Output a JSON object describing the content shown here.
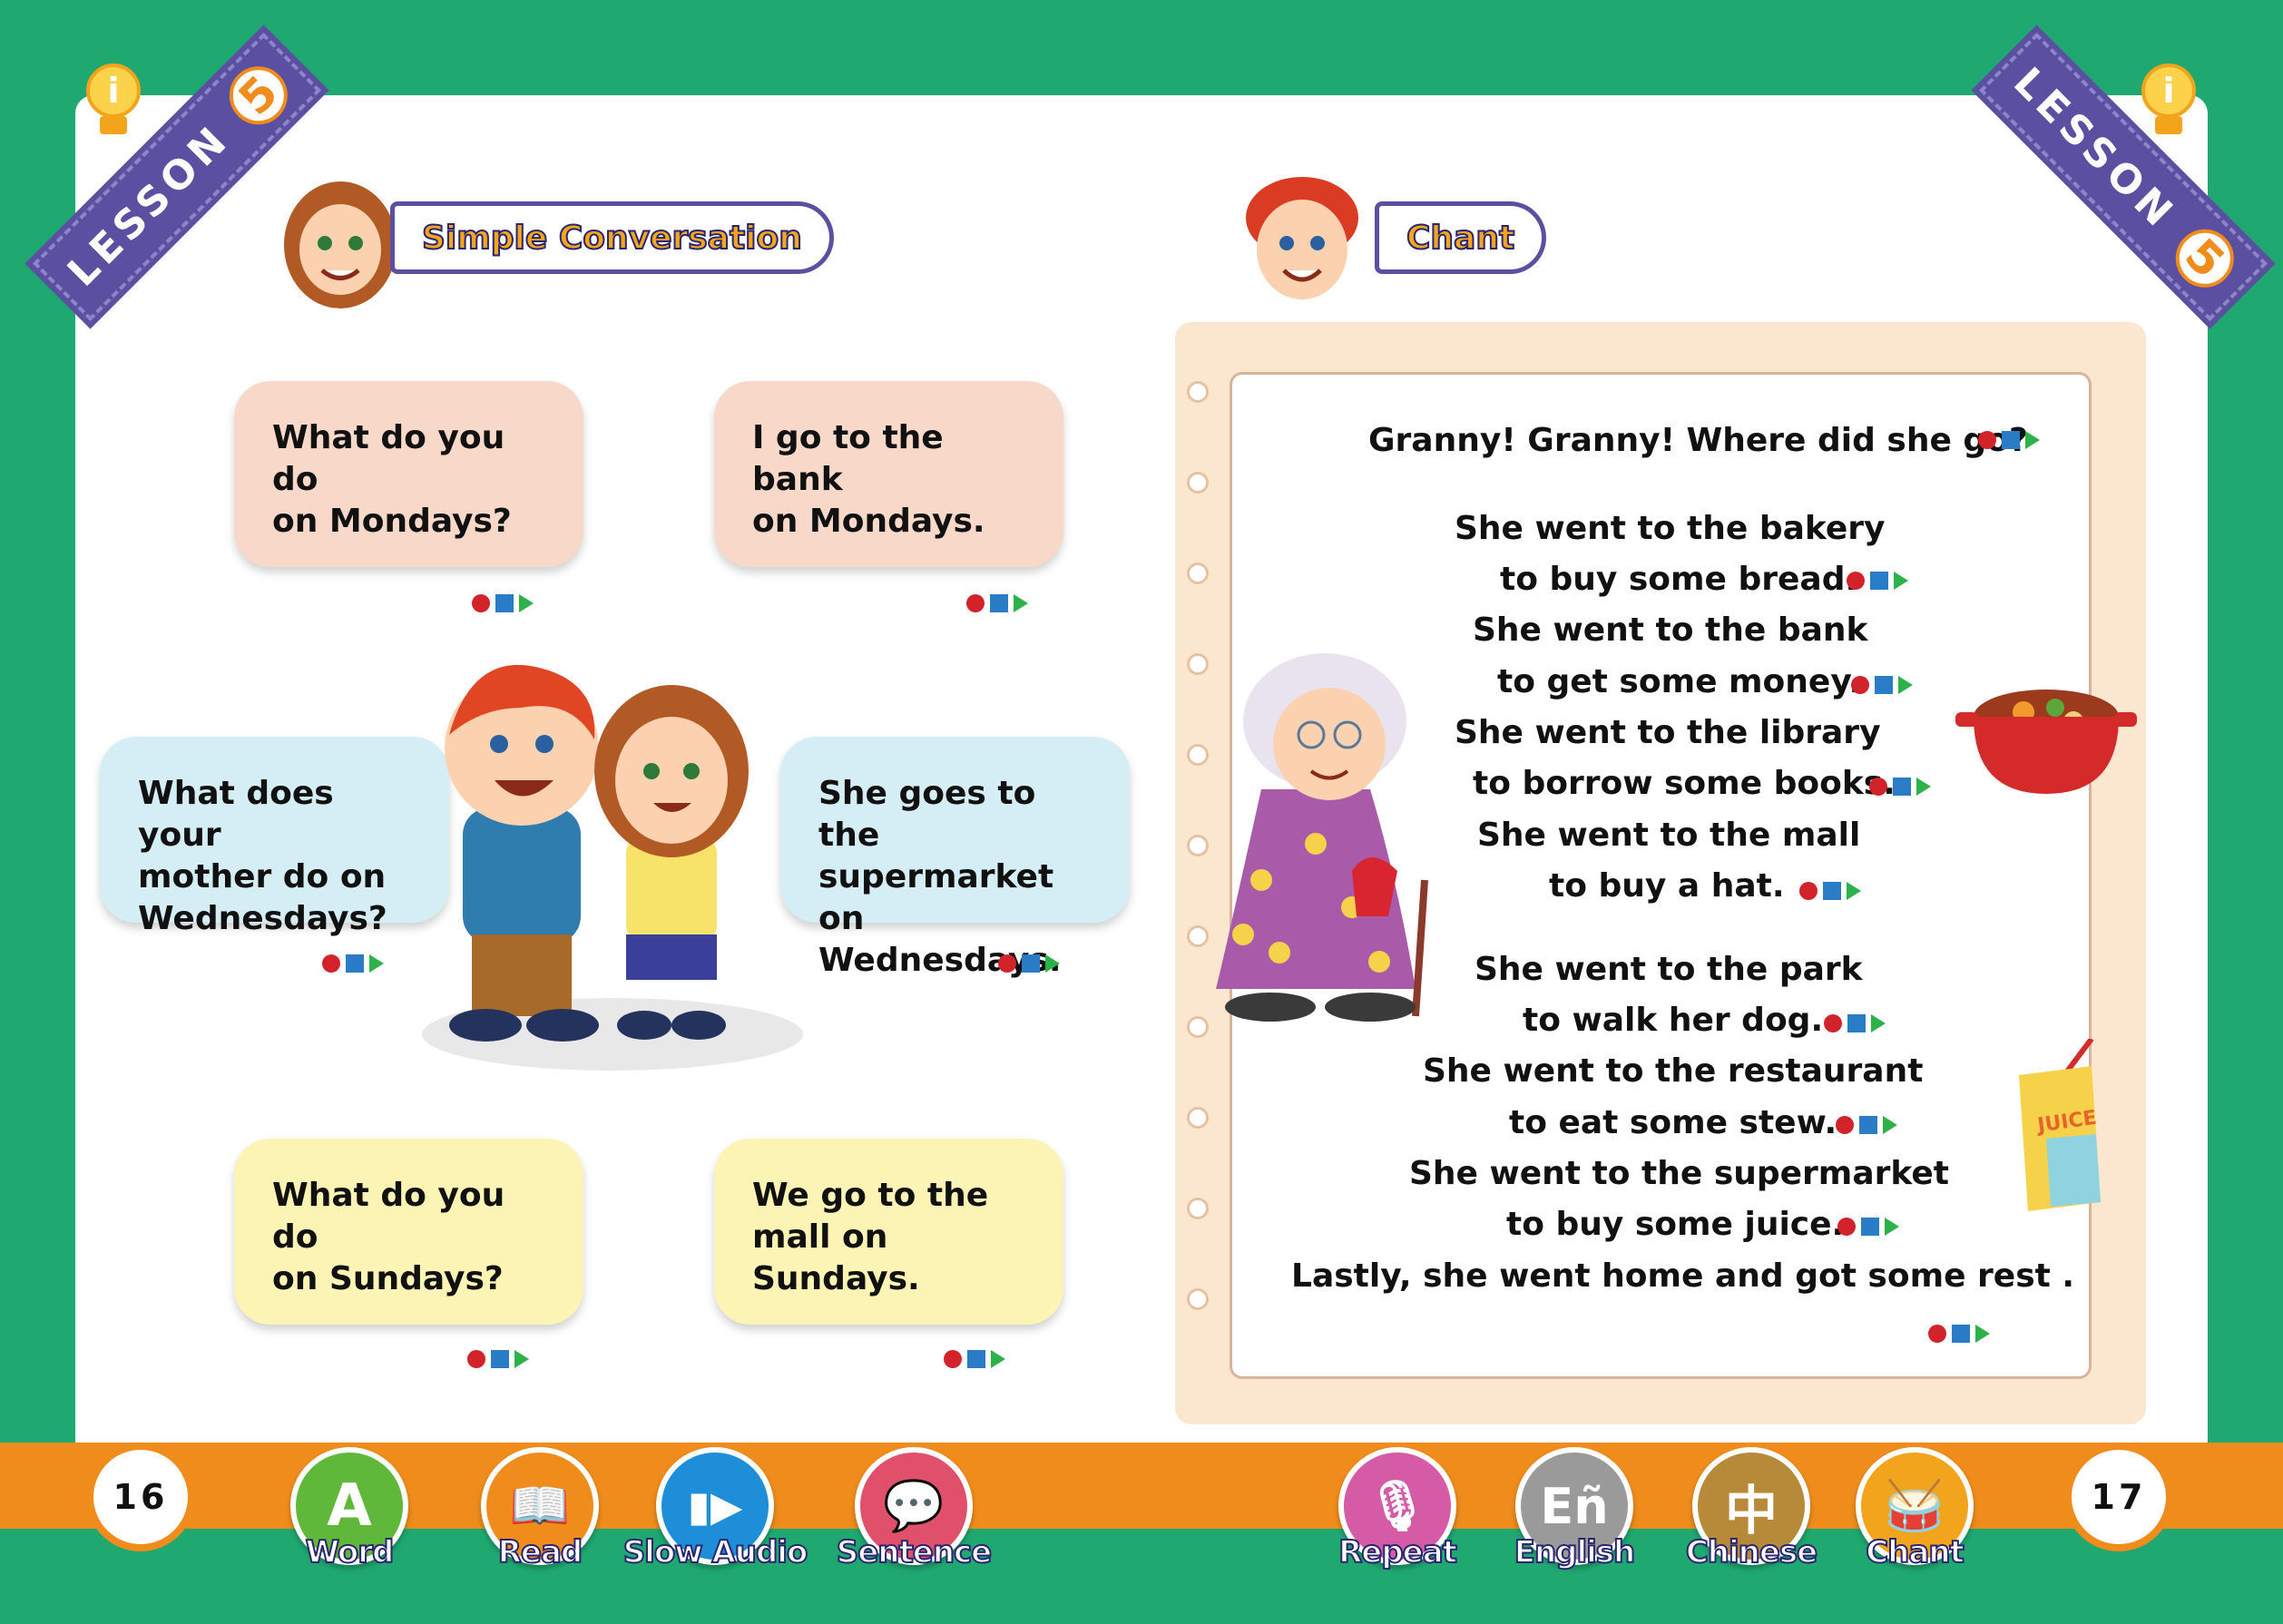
{
  "colors": {
    "background_green": "#1fa971",
    "lesson_ribbon": "#5a4fa0",
    "bottom_bar": "#ef8c1c",
    "bubble_pink": "#f8d9c9",
    "bubble_blue": "#d5edf5",
    "bubble_yellow": "#fbf4b5"
  },
  "lesson": {
    "label": "LESSON",
    "number": "5"
  },
  "left_page": {
    "section_title": "Simple Conversation",
    "bubbles": [
      {
        "lines": [
          "What do you do",
          "on Mondays?"
        ]
      },
      {
        "lines": [
          "I go to the bank",
          "on Mondays."
        ]
      },
      {
        "lines": [
          "What does your",
          "mother do on",
          "Wednesdays?"
        ]
      },
      {
        "lines": [
          "She goes to the",
          "supermarket  on",
          "Wednesdays."
        ]
      },
      {
        "lines": [
          "What do you do",
          "on Sundays?"
        ]
      },
      {
        "lines": [
          "We go to the",
          "mall on Sundays."
        ]
      }
    ],
    "page_number": "16"
  },
  "right_page": {
    "section_title": "Chant",
    "chant_lines": [
      "Granny! Granny! Where did she go?",
      "She went to the bakery",
      "to buy some bread.",
      "She went to the bank",
      "to get some money.",
      "She went to the library",
      "to borrow some books.",
      "She went to the mall",
      "to buy a hat.",
      "She went to the park",
      "to walk her dog.",
      "She went to the restaurant",
      "to eat some stew.",
      "She went to the supermarket",
      "to buy some juice.",
      "Lastly, she went home and  got some rest ."
    ],
    "juice_label": "JUICE",
    "page_number": "17"
  },
  "toolbar_left": [
    {
      "label": "Word",
      "icon": "letter-a-icon",
      "glyph": "A",
      "color": "#5fb83a"
    },
    {
      "label": "Read",
      "icon": "book-pencil-icon",
      "glyph": "📖",
      "color": "#ef8c1c"
    },
    {
      "label": "Slow Audio",
      "icon": "slow-play-icon",
      "glyph": "▮▶",
      "color": "#1e8ed8"
    },
    {
      "label": "Sentence",
      "icon": "speech-bubble-icon",
      "glyph": "💬",
      "color": "#e0506b"
    }
  ],
  "toolbar_right": [
    {
      "label": "Repeat",
      "icon": "microphone-icon",
      "glyph": "🎙",
      "color": "#d65ba6"
    },
    {
      "label": "English",
      "icon": "english-en-icon",
      "glyph": "Eñ",
      "color": "#9a9a9a"
    },
    {
      "label": "Chinese",
      "icon": "chinese-zhong-icon",
      "glyph": "中",
      "color": "#b78a3a"
    },
    {
      "label": "Chant",
      "icon": "drum-icon",
      "glyph": "🥁",
      "color": "#f2a41c"
    }
  ]
}
